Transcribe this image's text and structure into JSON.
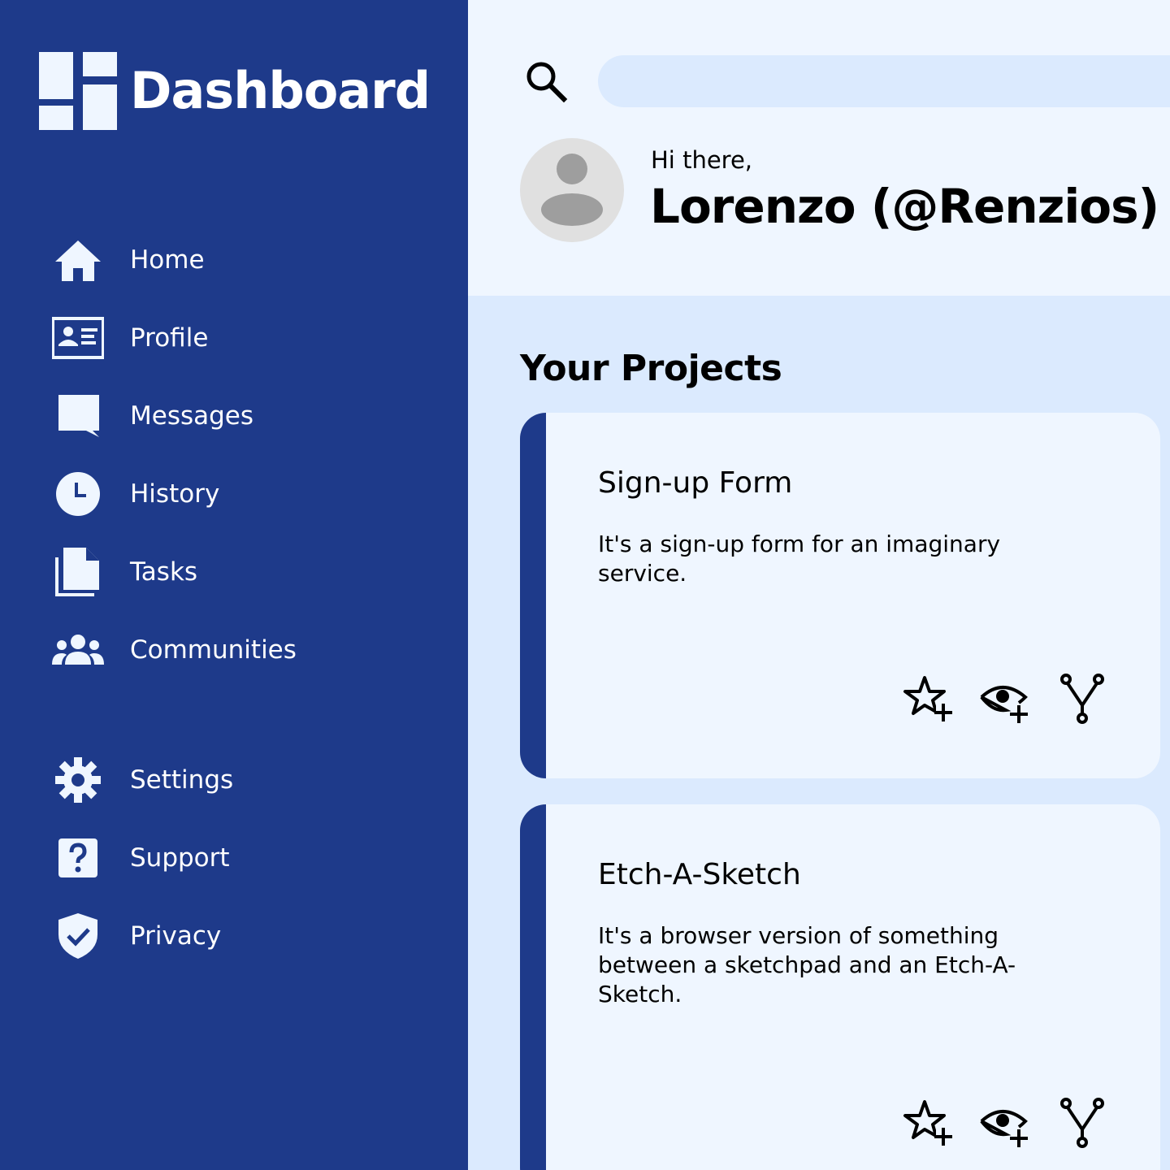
{
  "app": {
    "title": "Dashboard",
    "logo_icon": "dashboard-icon"
  },
  "colors": {
    "sidebar": "#1e3a8a",
    "accent_bg": "#dbeafe",
    "card_bg": "#eff6ff"
  },
  "sidebar": {
    "items": [
      {
        "label": "Home",
        "icon": "home-icon"
      },
      {
        "label": "Profile",
        "icon": "id-card-icon"
      },
      {
        "label": "Messages",
        "icon": "message-icon"
      },
      {
        "label": "History",
        "icon": "clock-icon"
      },
      {
        "label": "Tasks",
        "icon": "documents-icon"
      },
      {
        "label": "Communities",
        "icon": "people-icon"
      }
    ],
    "bottom_items": [
      {
        "label": "Settings",
        "icon": "gear-icon"
      },
      {
        "label": "Support",
        "icon": "help-icon"
      },
      {
        "label": "Privacy",
        "icon": "shield-check-icon"
      }
    ]
  },
  "search": {
    "placeholder": "",
    "value": ""
  },
  "user": {
    "greeting": "Hi there,",
    "name": "Lorenzo (@Renzios)"
  },
  "projects": {
    "title": "Your Projects",
    "items": [
      {
        "title": "Sign-up Form",
        "description": "It's a sign-up form for an imaginary service.",
        "actions": [
          "star-plus-icon",
          "eye-plus-icon",
          "fork-icon"
        ]
      },
      {
        "title": "Etch-A-Sketch",
        "description": "It's a browser version of something between a sketchpad and an Etch-A-Sketch.",
        "actions": [
          "star-plus-icon",
          "eye-plus-icon",
          "fork-icon"
        ]
      }
    ]
  }
}
